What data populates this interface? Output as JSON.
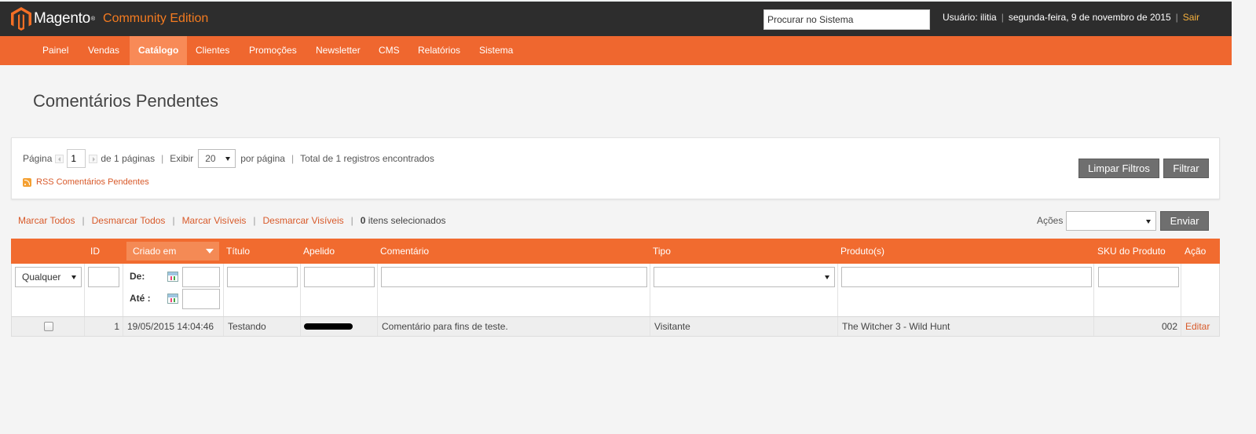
{
  "header": {
    "brand": "Magento",
    "brand_mark": "®",
    "edition": "Community Edition",
    "search_placeholder": "Procurar no Sistema",
    "user_label": "Usuário: ilitia",
    "date": "segunda-feira, 9 de novembro de 2015",
    "logout": "Sair",
    "logo_color": "#f46f25"
  },
  "nav": {
    "items": [
      {
        "label": "Painel"
      },
      {
        "label": "Vendas"
      },
      {
        "label": "Catálogo",
        "active": true
      },
      {
        "label": "Clientes"
      },
      {
        "label": "Promoções"
      },
      {
        "label": "Newsletter"
      },
      {
        "label": "CMS"
      },
      {
        "label": "Relatórios"
      },
      {
        "label": "Sistema"
      }
    ]
  },
  "page": {
    "title": "Comentários Pendentes"
  },
  "pager": {
    "page_label": "Página",
    "page_value": "1",
    "of_pages": "de 1 páginas",
    "show_label": "Exibir",
    "limit": "20",
    "per_page": "por página",
    "total": "Total de 1 registros encontrados",
    "rss": "RSS Comentários Pendentes",
    "reset_button": "Limpar Filtros",
    "search_button": "Filtrar"
  },
  "massaction": {
    "select_all": "Marcar Todos",
    "unselect_all": "Desmarcar Todos",
    "select_visible": "Marcar Visíveis",
    "unselect_visible": "Desmarcar Visíveis",
    "count": "0",
    "count_suffix": " itens selecionados",
    "actions_label": "Ações",
    "actions_value": "",
    "submit": "Enviar"
  },
  "grid": {
    "columns": [
      "",
      "ID",
      "Criado em",
      "Título",
      "Apelido",
      "Comentário",
      "Tipo",
      "Produto(s)",
      "SKU do Produto",
      "Ação"
    ],
    "filters": {
      "massaction_select": "Qualquer",
      "date_from": "De:",
      "date_to": "Até :",
      "type_select": ""
    },
    "rows": [
      {
        "id": "1",
        "created": "19/05/2015 14:04:46",
        "title": "Testando",
        "nickname": "",
        "comment": "Comentário para fins de teste.",
        "type": "Visitante",
        "product": "The Witcher 3 - Wild Hunt",
        "sku": "002",
        "action": "Editar"
      }
    ]
  }
}
